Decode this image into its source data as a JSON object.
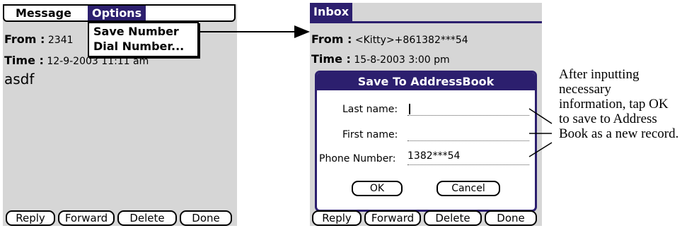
{
  "left_screen": {
    "menus": [
      "Message",
      "Options"
    ],
    "options_menu_items": [
      "Save Number",
      "Dial Number..."
    ],
    "from_label": "From :",
    "from_value": "2341",
    "time_label": "Time :",
    "time_value": "12-9-2003  11:11 am",
    "message_body": "asdf",
    "buttons": [
      "Reply",
      "Forward",
      "Delete",
      "Done"
    ]
  },
  "right_screen": {
    "tab_title": "Inbox",
    "from_label": "From :",
    "from_value": "<Kitty>+861382***54",
    "time_label": "Time :",
    "time_value": "15-8-2003  3:00 pm",
    "dialog": {
      "title": "Save To AddressBook",
      "fields": [
        {
          "label": "Last name:",
          "value": ""
        },
        {
          "label": "First name:",
          "value": ""
        },
        {
          "label": "Phone Number:",
          "value": "1382***54"
        }
      ],
      "ok_label": "OK",
      "cancel_label": "Cancel"
    },
    "bottom_buttons": [
      "Reply",
      "Forward",
      "Delete",
      "Done"
    ]
  },
  "annotation_text": "After inputting necessary information, tap OK to save to Address Book as a new record.",
  "colors": {
    "title_bar": "#2c1f6e",
    "screen_bg": "#d6d6d6"
  }
}
